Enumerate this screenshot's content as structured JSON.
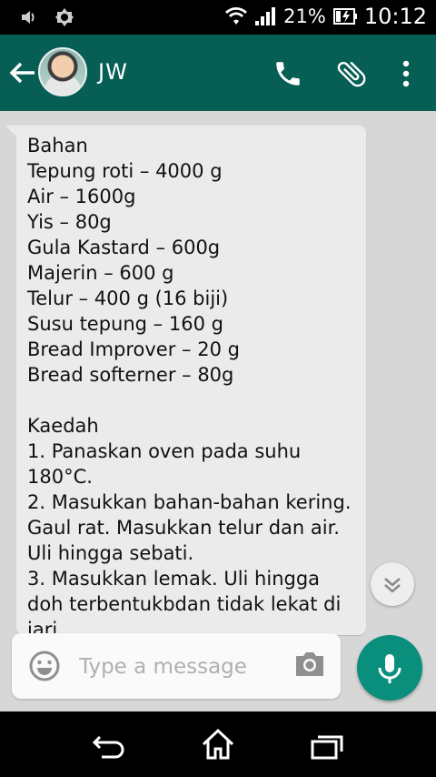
{
  "status_bar": {
    "battery_percent": "21%",
    "time": "10:12",
    "icons": [
      "volume-icon",
      "brightness-icon",
      "wifi-icon",
      "signal-icon",
      "battery-icon"
    ]
  },
  "header": {
    "contact_name": "JW",
    "icons": [
      "back-arrow-icon",
      "avatar",
      "phone-icon",
      "paperclip-icon",
      "more-vert-icon"
    ],
    "color": "#075e54"
  },
  "chat": {
    "message_text": "Bahan\nTepung roti – 4000 g\nAir – 1600g\nYis – 80g\nGula Kastard – 600g\nMajerin – 600 g\nTelur – 400 g (16 biji)\nSusu tepung – 160 g\nBread Improver – 20 g\nBread softerner – 80g\n\nKaedah\n1. Panaskan oven pada suhu 180°C.\n2. Masukkan bahan-bahan kering. Gaul rat. Masukkan telur dan air. Uli hingga sebati.\n3. Masukkan lemak. Uli hingga doh terbentukbdan tidak lekat di jari",
    "background": "#d7d7d7",
    "bubble_color": "#ebebeb"
  },
  "composer": {
    "placeholder": "Type a message",
    "icons": [
      "emoji-icon",
      "camera-icon",
      "mic-icon",
      "chevron-double-down-icon"
    ],
    "mic_color": "#0a8f7c"
  },
  "nav_bar": {
    "icons": [
      "back-icon",
      "home-icon",
      "recent-apps-icon"
    ]
  }
}
